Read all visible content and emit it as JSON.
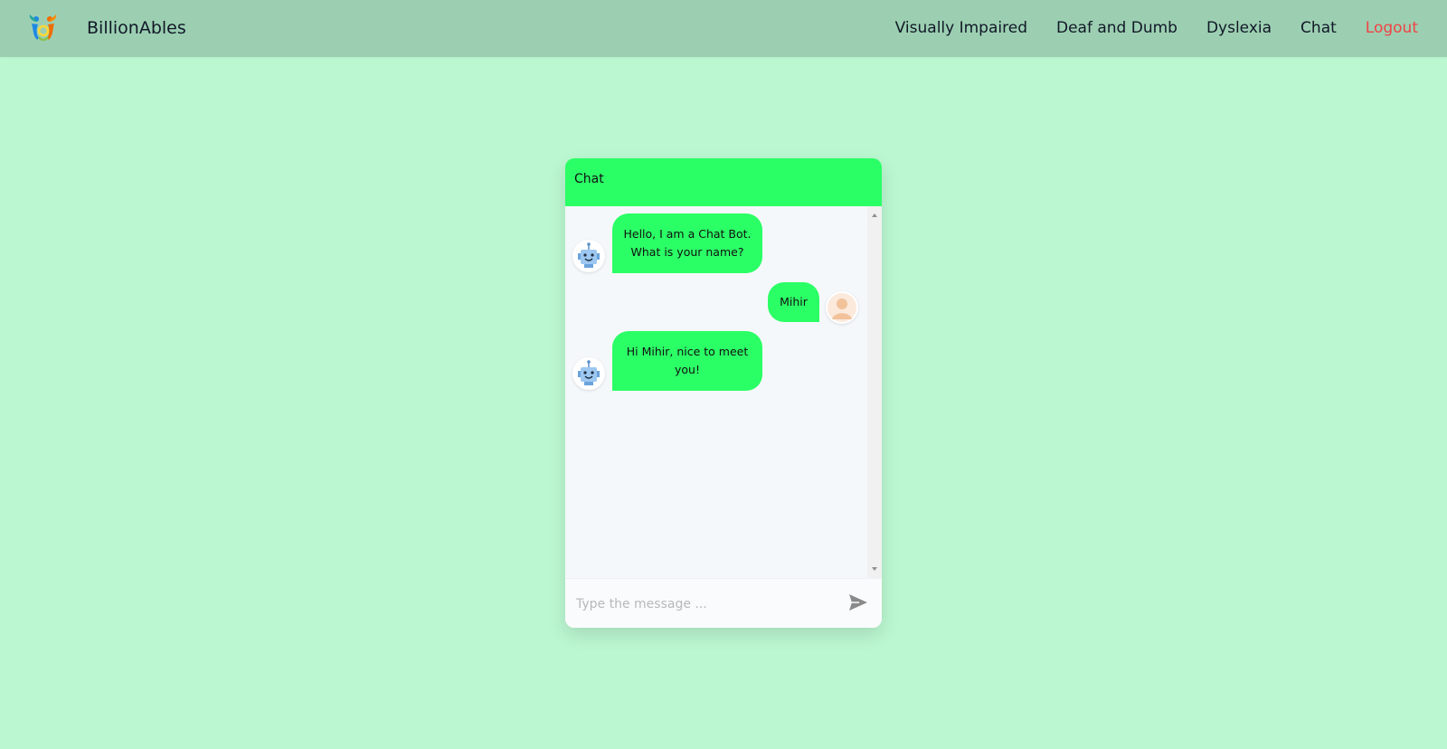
{
  "navbar": {
    "brand": "BillionAbles",
    "links": [
      {
        "label": "Visually Impaired"
      },
      {
        "label": "Deaf and Dumb"
      },
      {
        "label": "Dyslexia"
      },
      {
        "label": "Chat"
      },
      {
        "label": "Logout",
        "color": "#ef4444"
      }
    ]
  },
  "chat": {
    "title": "Chat",
    "header_color": "#2bff66",
    "bubble_color": "#2bff66",
    "messages": [
      {
        "sender": "bot",
        "avatar_icon": "robot-icon",
        "lines": [
          "Hello, I am a Chat Bot.",
          "What is your name?"
        ]
      },
      {
        "sender": "user",
        "avatar_icon": "user-avatar-icon",
        "lines": [
          "Mihir"
        ]
      },
      {
        "sender": "bot",
        "avatar_icon": "robot-icon",
        "lines": [
          "Hi Mihir, nice to meet",
          "you!"
        ]
      }
    ],
    "input": {
      "placeholder": "Type the message ...",
      "value": ""
    },
    "send_icon": "send-icon"
  },
  "colors": {
    "page_background": "#bbf7d1",
    "navbar_background": "#9ccfb2"
  }
}
